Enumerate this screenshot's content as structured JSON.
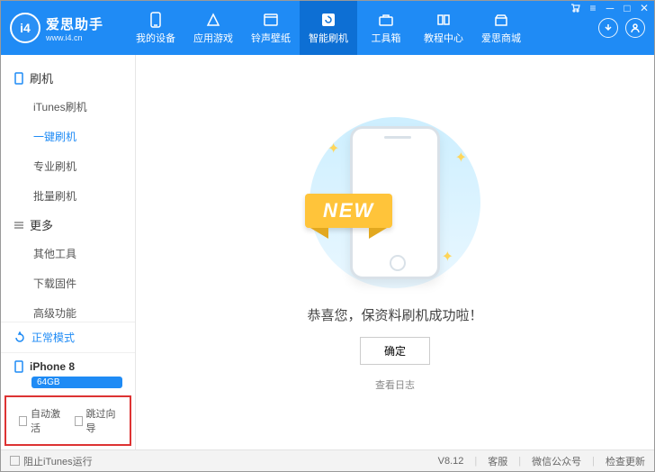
{
  "app": {
    "name": "爱思助手",
    "url": "www.i4.cn"
  },
  "nav": [
    {
      "label": "我的设备"
    },
    {
      "label": "应用游戏"
    },
    {
      "label": "铃声壁纸"
    },
    {
      "label": "智能刷机"
    },
    {
      "label": "工具箱"
    },
    {
      "label": "教程中心"
    },
    {
      "label": "爱思商城"
    }
  ],
  "sidebar": {
    "section1": "刷机",
    "items1": [
      "iTunes刷机",
      "一键刷机",
      "专业刷机",
      "批量刷机"
    ],
    "section2": "更多",
    "items2": [
      "其他工具",
      "下载固件",
      "高级功能"
    ]
  },
  "mode": "正常模式",
  "device": {
    "name": "iPhone 8",
    "badge": "64GB"
  },
  "bottom_checks": {
    "auto_activate": "自动激活",
    "skip_guide": "跳过向导"
  },
  "main": {
    "ribbon": "NEW",
    "message": "恭喜您，保资料刷机成功啦！",
    "ok": "确定",
    "log": "查看日志"
  },
  "status": {
    "block": "阻止iTunes运行",
    "version": "V8.12",
    "service": "客服",
    "wechat": "微信公众号",
    "update": "检查更新"
  }
}
